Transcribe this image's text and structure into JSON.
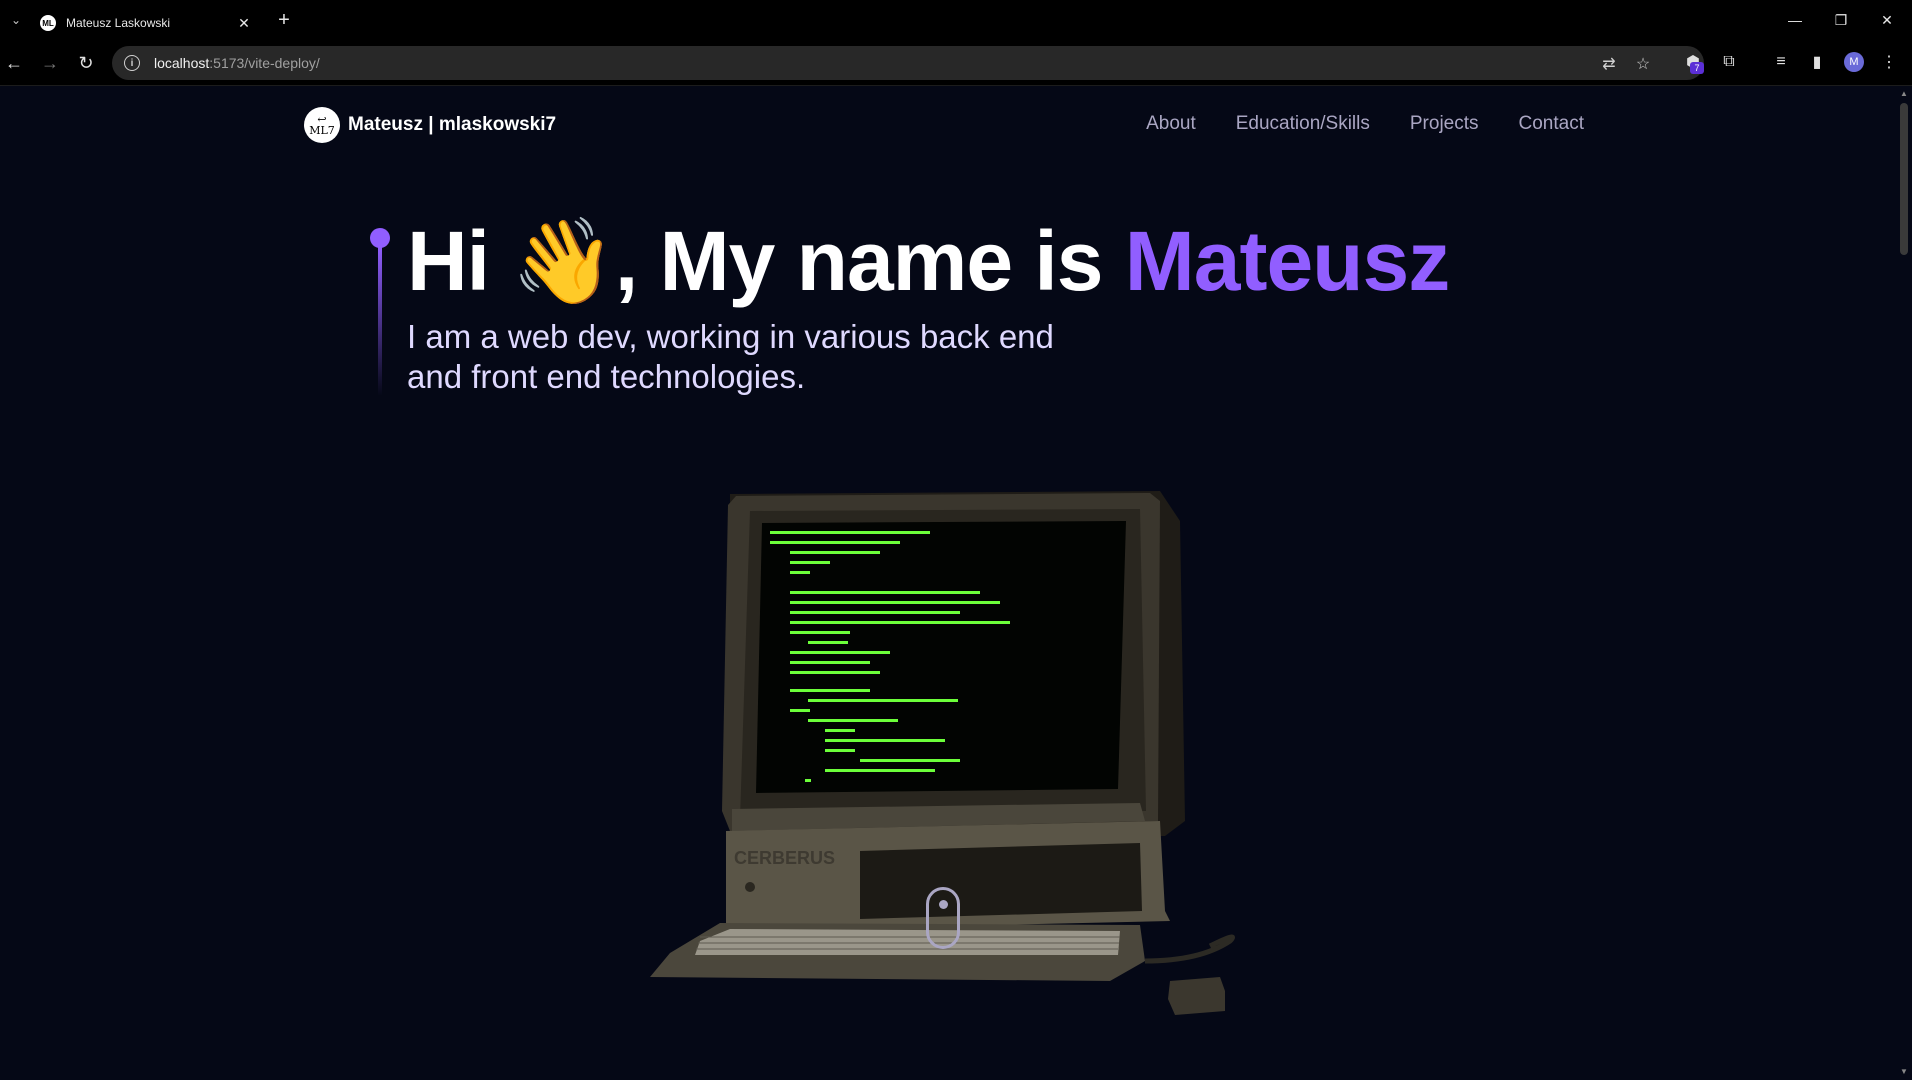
{
  "browser": {
    "tab_title": "Mateusz Laskowski",
    "url_host": "localhost",
    "url_path": ":5173/vite-deploy/",
    "extension_badge": "7",
    "profile_initial": "M"
  },
  "site": {
    "logo_badge_top": "↩",
    "logo_badge_bottom": "ML7",
    "brand": "Mateusz | mlaskowski7",
    "nav": [
      "About",
      "Education/Skills",
      "Projects",
      "Contact"
    ]
  },
  "hero": {
    "title_prefix": "Hi 👋, My name is ",
    "title_accent": "Mateusz",
    "subtitle": "I am a web dev, working in various back end and front end technologies.",
    "accent_color": "#915eff"
  },
  "computer": {
    "brand_label": "CERBERUS"
  }
}
